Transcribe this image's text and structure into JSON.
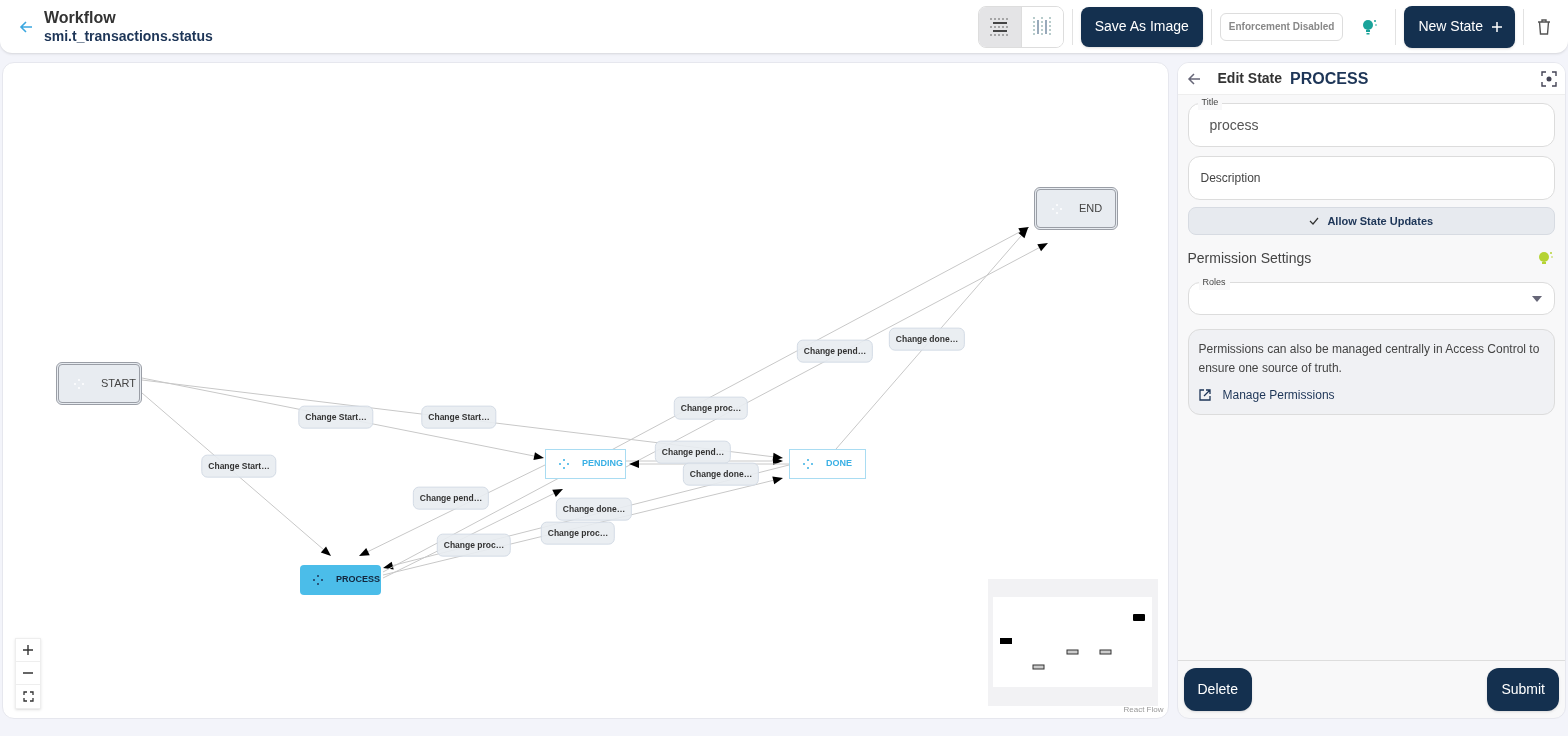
{
  "header": {
    "title": "Workflow",
    "subtitle": "smi.t_transactions.status"
  },
  "layout_toggles": [
    {
      "kind": "rows",
      "selected": true
    },
    {
      "kind": "columns",
      "selected": false
    }
  ],
  "toolbar": {
    "save_button": "Save As Image",
    "enforcement": {
      "label": "Enforcement Disabled",
      "enabled": false
    },
    "new_state_button": "New State"
  },
  "nodes": [
    {
      "label": "START",
      "kind": "terminal",
      "selected": false
    },
    {
      "label": "END",
      "kind": "terminal",
      "selected": false
    },
    {
      "label": "PENDING",
      "kind": "state",
      "selected": false
    },
    {
      "label": "DONE",
      "kind": "state",
      "selected": false
    },
    {
      "label": "PROCESS",
      "kind": "state",
      "selected": true
    }
  ],
  "edges": [
    {
      "label": "Change Start…"
    },
    {
      "label": "Change Start…"
    },
    {
      "label": "Change Start…"
    },
    {
      "label": "Change pend…"
    },
    {
      "label": "Change proc…"
    },
    {
      "label": "Change done…"
    },
    {
      "label": "Change proc…"
    },
    {
      "label": "Change proc…"
    },
    {
      "label": "Change pend…"
    },
    {
      "label": "Change done…"
    },
    {
      "label": "Change pend…"
    },
    {
      "label": "Change done…"
    }
  ],
  "attribution": "React Flow",
  "editor": {
    "heading": "Edit State",
    "state_name": "PROCESS",
    "title_field": {
      "label": "Title",
      "value": "process"
    },
    "description_field": {
      "placeholder": "Description"
    },
    "allow_updates": {
      "label": "Allow State Updates",
      "checked": true
    },
    "permission_heading": "Permission Settings",
    "roles_field": {
      "label": "Roles"
    },
    "info": "Permissions can also be managed centrally in Access Control to ensure one source of truth.",
    "manage_link": "Manage Permissions",
    "delete_button": "Delete",
    "submit_button": "Submit"
  }
}
